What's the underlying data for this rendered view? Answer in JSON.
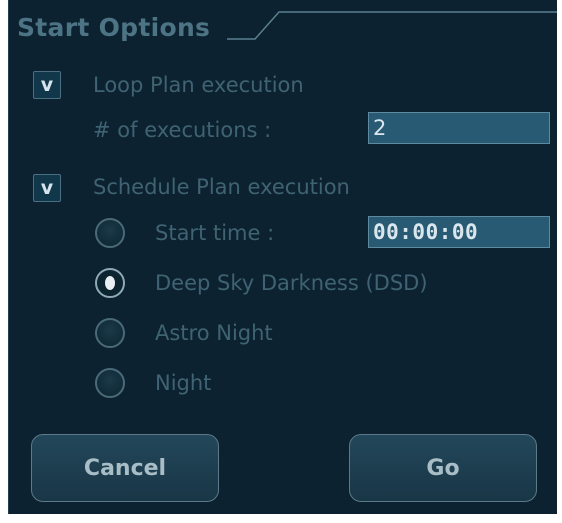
{
  "group": {
    "title": "Start Options"
  },
  "loop": {
    "checkbox_mark": "v",
    "label": "Loop Plan execution",
    "executions_label": "# of executions :",
    "executions_value": "2"
  },
  "schedule": {
    "checkbox_mark": "v",
    "label": "Schedule Plan execution",
    "start_time_label": "Start time :",
    "start_time_value": "00:00:00",
    "options": [
      {
        "label": "Start time :",
        "selected": false
      },
      {
        "label": "Deep Sky Darkness (DSD)",
        "selected": true
      },
      {
        "label": "Astro Night",
        "selected": false
      },
      {
        "label": "Night",
        "selected": false
      }
    ]
  },
  "buttons": {
    "cancel": "Cancel",
    "go": "Go"
  },
  "colors": {
    "panel_bg": "#0d2230",
    "label_text": "#3f6373",
    "field_bg": "#285a73",
    "button_bg": "#1d3f51"
  }
}
